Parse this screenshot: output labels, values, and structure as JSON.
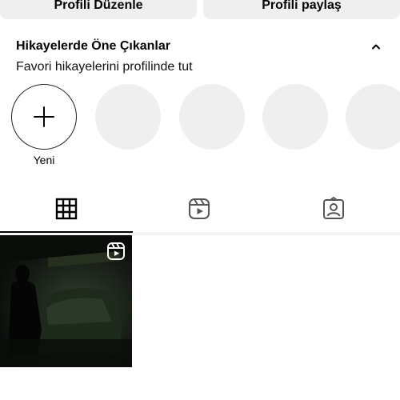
{
  "profile_buttons": {
    "edit_label": "Profili Düzenle",
    "share_label": "Profili paylaş"
  },
  "highlights": {
    "title": "Hikayelerde Öne Çıkanlar",
    "subtitle": "Favori hikayelerini profilinde tut",
    "new_label": "Yeni",
    "placeholder_count": 4
  },
  "tabs": [
    {
      "icon": "grid-icon",
      "active": true
    },
    {
      "icon": "reels-icon",
      "active": false
    },
    {
      "icon": "tagged-icon",
      "active": false
    }
  ],
  "posts": [
    {
      "type": "reel",
      "badge_icon": "reels-icon"
    }
  ],
  "colors": {
    "button_bg": "#efefef",
    "placeholder_bg": "#efefef",
    "active_tab": "#000000",
    "text": "#000000"
  }
}
